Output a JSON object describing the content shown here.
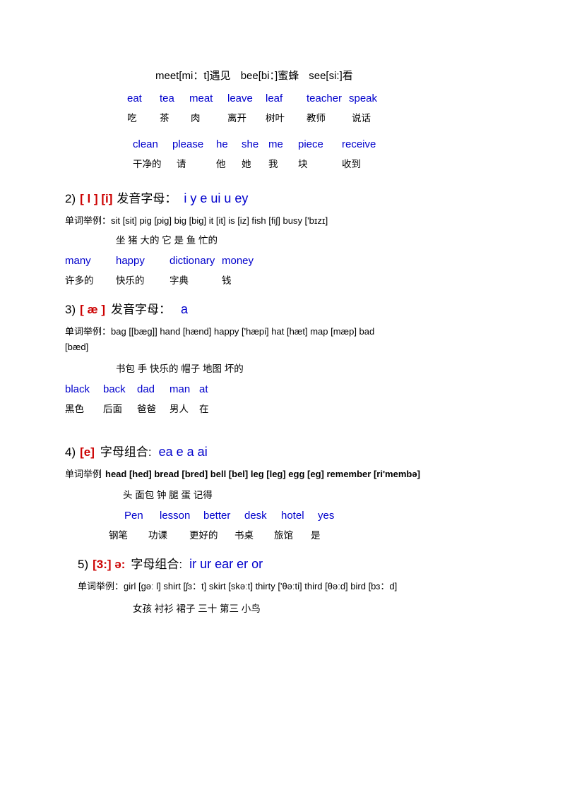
{
  "document": {
    "top_block": {
      "line1": "meet[mi：t]遇见",
      "line1b": "bee[bi：]蜜蜂",
      "line1c": "see[si:]看",
      "words_row1": [
        "eat",
        "tea",
        "meat",
        "leave",
        "leaf",
        "teacher",
        "speak"
      ],
      "cn_row1": [
        "吃",
        "茶",
        "肉",
        "离开",
        "树叶",
        "教师",
        "说话"
      ],
      "words_row2": [
        "clean",
        "please",
        "he",
        "she",
        "me",
        "piece",
        "receive"
      ],
      "cn_row2": [
        "干净的",
        "请",
        "他",
        "她",
        "我",
        "块",
        "收到"
      ]
    },
    "sections": [
      {
        "number": "2)",
        "ipa": "[ l ] [i]",
        "cn_label": "发音字母：",
        "letters": "i   y   e   ui   u   ey",
        "examples_label": "单词举例：",
        "examples": "sit [sit]   pig [piɡ]   big [biɡ]   it [it]   is [iz]   fish [fiʃ]   busy ['bɪzɪ]",
        "cn_line1": "坐        猪       大的      它      是      鱼        忙的",
        "words_row": [
          "many",
          "happy",
          "dictionary",
          "money"
        ],
        "cn_row": [
          "许多的",
          "快乐的",
          "字典",
          "钱"
        ]
      },
      {
        "number": "3)",
        "ipa": "[ æ ]",
        "cn_label": "发音字母：",
        "letters": "a",
        "examples_label": "单词举例：",
        "examples": "bag [[bæɡ]]   hand [hænd]   happy ['hæpi]   hat [hæt]   map [mæp]   bad",
        "examples_cont": "[bæd]",
        "cn_line1": "书包            手            快乐的         帽子       地图        坏的",
        "words_row": [
          "black",
          "back",
          "dad",
          "man",
          "at"
        ],
        "cn_row": [
          "黑色",
          "后面",
          "爸爸",
          "男人",
          "在"
        ]
      },
      {
        "number": "4)",
        "ipa": "[e]",
        "cn_label": "字母组合:",
        "letters": "ea      e    a    ai",
        "examples_label": "单词举例",
        "examples": "head [hed] bread [bred] bell [bel] leg [leg] egg [eg] remember [ri'membə]",
        "cn_line1": "头           面包          钟        腿        蛋         记得",
        "words_row": [
          "Pen",
          "lesson",
          "better",
          "desk",
          "hotel",
          "yes"
        ],
        "cn_row": [
          "钢笔",
          "功课",
          "更好的",
          "书桌",
          "旅馆",
          "是"
        ]
      },
      {
        "number": "5)",
        "ipa": "[3:] ə:",
        "cn_label": "字母组合:",
        "letters": "ir    ur    ear er      or",
        "examples_label": "单词举例：",
        "examples": "girl [ɡəː l]   shirt [ʃɜ：t]   skirt [skəːt]   thirty ['θəːti]   third [θəːd]   bird [bɜ：d]",
        "cn_line1": "女孩        衬衫          裙子          三十          第三         小鸟"
      }
    ]
  }
}
